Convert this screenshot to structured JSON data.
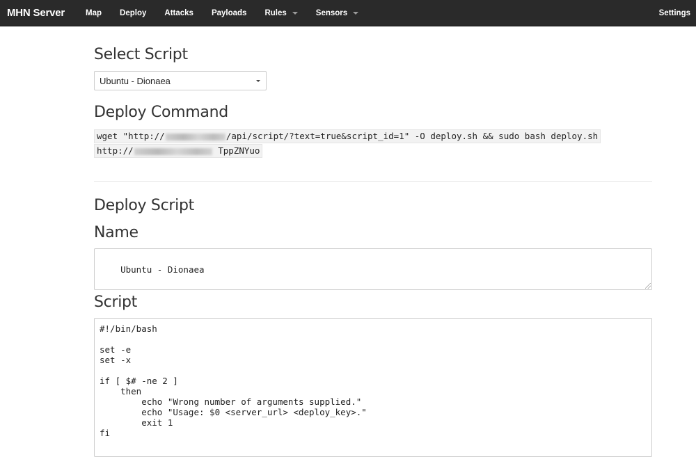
{
  "navbar": {
    "brand": "MHN Server",
    "items": [
      {
        "label": "Map",
        "dropdown": false
      },
      {
        "label": "Deploy",
        "dropdown": false
      },
      {
        "label": "Attacks",
        "dropdown": false
      },
      {
        "label": "Payloads",
        "dropdown": false
      },
      {
        "label": "Rules",
        "dropdown": true
      },
      {
        "label": "Sensors",
        "dropdown": true
      }
    ],
    "settings": "Settings"
  },
  "select_script": {
    "heading": "Select Script",
    "selected": "Ubuntu - Dionaea"
  },
  "deploy_command": {
    "heading": "Deploy Command",
    "line1_prefix": "wget \"http://",
    "line1_suffix": "/api/script/?text=true&script_id=1\" -O deploy.sh && sudo bash deploy.sh",
    "line2_prefix": "http://",
    "line2_suffix": " TppZNYuo"
  },
  "deploy_script": {
    "heading": "Deploy Script",
    "name_label": "Name",
    "name_value": "Ubuntu - Dionaea",
    "script_label": "Script",
    "script_lines": [
      "#!/bin/bash",
      "",
      "set -e",
      "set -x",
      "",
      "if [ $# -ne 2 ]",
      "    then",
      "        echo \"Wrong number of arguments supplied.\"",
      "        echo \"Usage: $0 <server_url> <deploy_key>.\"",
      "        exit 1",
      "fi"
    ]
  },
  "colors": {
    "navbar_bg": "#2a2a2a",
    "text": "#333333"
  }
}
